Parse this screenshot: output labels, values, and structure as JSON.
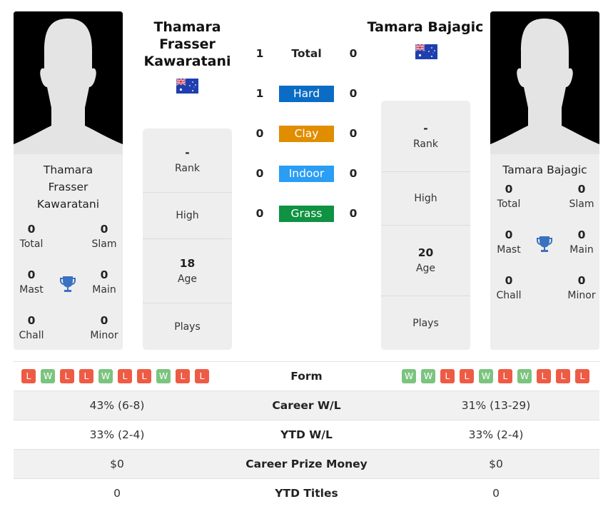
{
  "colors": {
    "hard": "#0a6cc4",
    "clay": "#e08d00",
    "indoor": "#2a9df4",
    "grass": "#0f9241",
    "win": "#7bc47f",
    "loss": "#ee5b45",
    "trophy": "#3a72c0"
  },
  "player1": {
    "name": "Thamara Frasser Kawaratani",
    "card_name_lines": [
      "Thamara",
      "Frasser",
      "Kawaratani"
    ],
    "header_name_lines": [
      "Thamara",
      "Frasser",
      "Kawaratani"
    ],
    "flag": "australia-flag-icon",
    "titles": {
      "total": {
        "value": "0",
        "label": "Total"
      },
      "slam": {
        "value": "0",
        "label": "Slam"
      },
      "mast": {
        "value": "0",
        "label": "Mast"
      },
      "main": {
        "value": "0",
        "label": "Main"
      },
      "chall": {
        "value": "0",
        "label": "Chall"
      },
      "minor": {
        "value": "0",
        "label": "Minor"
      }
    },
    "info": {
      "rank": {
        "value": "-",
        "label": "Rank"
      },
      "high": {
        "value": "",
        "label": "High"
      },
      "age": {
        "value": "18",
        "label": "Age"
      },
      "plays": {
        "value": "",
        "label": "Plays"
      }
    },
    "form": [
      "L",
      "W",
      "L",
      "L",
      "W",
      "L",
      "L",
      "W",
      "L",
      "L"
    ],
    "career_wl": "43% (6-8)",
    "ytd_wl": "33% (2-4)",
    "prize_money": "$0",
    "ytd_titles": "0"
  },
  "player2": {
    "name": "Tamara Bajagic",
    "card_name_lines": [
      "Tamara Bajagic"
    ],
    "header_name_lines": [
      "Tamara Bajagic"
    ],
    "flag": "australia-flag-icon",
    "titles": {
      "total": {
        "value": "0",
        "label": "Total"
      },
      "slam": {
        "value": "0",
        "label": "Slam"
      },
      "mast": {
        "value": "0",
        "label": "Mast"
      },
      "main": {
        "value": "0",
        "label": "Main"
      },
      "chall": {
        "value": "0",
        "label": "Chall"
      },
      "minor": {
        "value": "0",
        "label": "Minor"
      }
    },
    "info": {
      "rank": {
        "value": "-",
        "label": "Rank"
      },
      "high": {
        "value": "",
        "label": "High"
      },
      "age": {
        "value": "20",
        "label": "Age"
      },
      "plays": {
        "value": "",
        "label": "Plays"
      }
    },
    "form": [
      "W",
      "W",
      "L",
      "L",
      "W",
      "L",
      "W",
      "L",
      "L",
      "L"
    ],
    "career_wl": "31% (13-29)",
    "ytd_wl": "33% (2-4)",
    "prize_money": "$0",
    "ytd_titles": "0"
  },
  "h2h": [
    {
      "label": "Total",
      "p1": "1",
      "p2": "0",
      "surface": "total"
    },
    {
      "label": "Hard",
      "p1": "1",
      "p2": "0",
      "surface": "hard"
    },
    {
      "label": "Clay",
      "p1": "0",
      "p2": "0",
      "surface": "clay"
    },
    {
      "label": "Indoor",
      "p1": "0",
      "p2": "0",
      "surface": "indoor"
    },
    {
      "label": "Grass",
      "p1": "0",
      "p2": "0",
      "surface": "grass"
    }
  ],
  "stats_labels": {
    "form": "Form",
    "career_wl": "Career W/L",
    "ytd_wl": "YTD W/L",
    "prize_money": "Career Prize Money",
    "ytd_titles": "YTD Titles"
  }
}
